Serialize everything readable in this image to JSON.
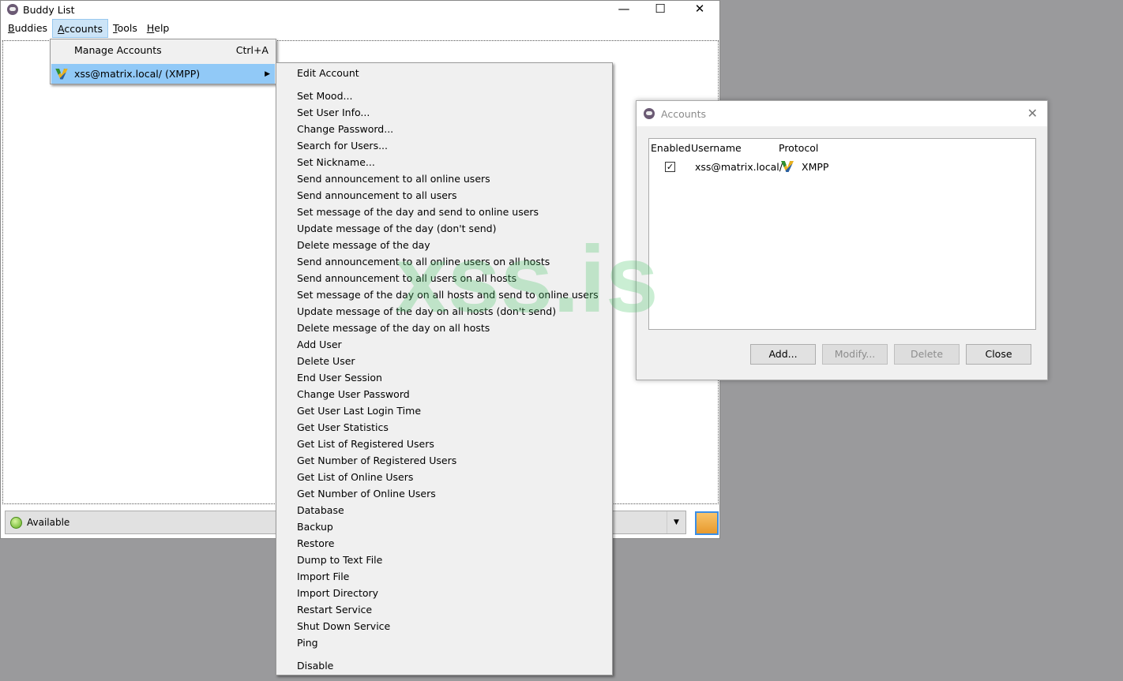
{
  "buddy_window": {
    "title": "Buddy List",
    "controls": {
      "minimize": "—",
      "maximize": "☐",
      "close": "✕"
    },
    "menubar": [
      {
        "label": "Buddies",
        "u": "B",
        "rest": "uddies"
      },
      {
        "label": "Accounts",
        "u": "A",
        "rest": "ccounts"
      },
      {
        "label": "Tools",
        "u": "T",
        "rest": "ools"
      },
      {
        "label": "Help",
        "u": "H",
        "rest": "elp"
      }
    ],
    "status": "Available"
  },
  "accounts_menu": {
    "manage": "Manage Accounts",
    "manage_shortcut": "Ctrl+A",
    "account": "xss@matrix.local/ (XMPP)"
  },
  "submenu": [
    "Edit Account",
    "Set Mood...",
    "Set User Info...",
    "Change Password...",
    "Search for Users...",
    "Set Nickname...",
    "Send announcement to all online users",
    "Send announcement to all users",
    "Set message of the day and send to online users",
    "Update message of the day (don't send)",
    "Delete message of the day",
    "Send announcement to all online users on all hosts",
    "Send announcement to all users on all hosts",
    "Set message of the day on all hosts and send to online users",
    "Update message of the day on all hosts (don't send)",
    "Delete message of the day on all hosts",
    "Add User",
    "Delete User",
    "End User Session",
    "Change User Password",
    "Get User Last Login Time",
    "Get User Statistics",
    "Get List of Registered Users",
    "Get Number of Registered Users",
    "Get List of Online Users",
    "Get Number of Online Users",
    "Database",
    "Backup",
    "Restore",
    "Dump to Text File",
    "Import File",
    "Import Directory",
    "Restart Service",
    "Shut Down Service",
    "Ping",
    "Disable"
  ],
  "accounts_dialog": {
    "title": "Accounts",
    "columns": [
      "Enabled",
      "Username",
      "Protocol"
    ],
    "rows": [
      {
        "enabled": true,
        "username": "xss@matrix.local/",
        "protocol": "XMPP"
      }
    ],
    "buttons": [
      "Add...",
      "Modify...",
      "Delete",
      "Close"
    ]
  },
  "watermark": "xss.is"
}
